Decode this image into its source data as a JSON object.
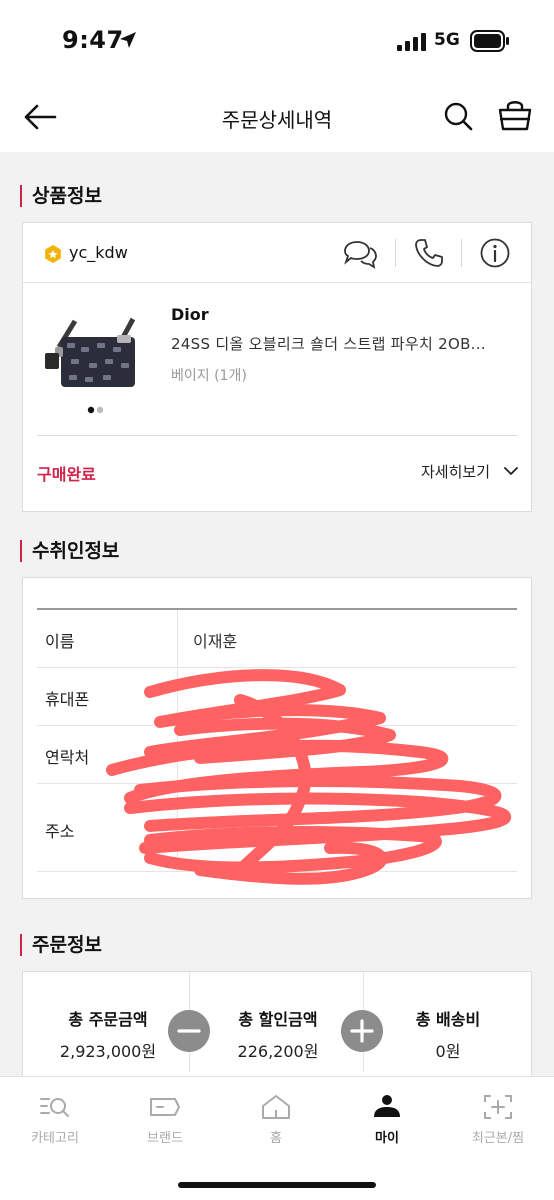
{
  "status_bar": {
    "time": "9:47",
    "network": "5G"
  },
  "header": {
    "title": "주문상세내역"
  },
  "product_section": {
    "title": "상품정보",
    "seller": "yc_kdw",
    "brand": "Dior",
    "name": "24SS 디올 오블리크 숄더 스트랩 파우치 2OB...",
    "option": "베이지 (1개)",
    "status": "구매완료",
    "detail_label": "자세히보기"
  },
  "recipient_section": {
    "title": "수취인정보",
    "rows": [
      {
        "label": "이름",
        "value": "이재훈"
      },
      {
        "label": "휴대폰",
        "value": ""
      },
      {
        "label": "연락처",
        "value": ""
      },
      {
        "label": "주소",
        "value": ""
      }
    ]
  },
  "order_section": {
    "title": "주문정보",
    "summary": [
      {
        "label": "총 주문금액",
        "value": "2,923,000원"
      },
      {
        "label": "총 할인금액",
        "value": "226,200원"
      },
      {
        "label": "총 배송비",
        "value": "0원"
      }
    ]
  },
  "bottom_nav": [
    {
      "label": "카테고리",
      "icon": "category-search-icon",
      "active": false
    },
    {
      "label": "브랜드",
      "icon": "tag-icon",
      "active": false
    },
    {
      "label": "홈",
      "icon": "home-icon",
      "active": false
    },
    {
      "label": "마이",
      "icon": "person-icon",
      "active": true
    },
    {
      "label": "최근본/찜",
      "icon": "recent-icon",
      "active": false
    }
  ],
  "colors": {
    "accent": "#d0234a",
    "redaction": "#ff5a5a",
    "badge": "#f0b400"
  }
}
